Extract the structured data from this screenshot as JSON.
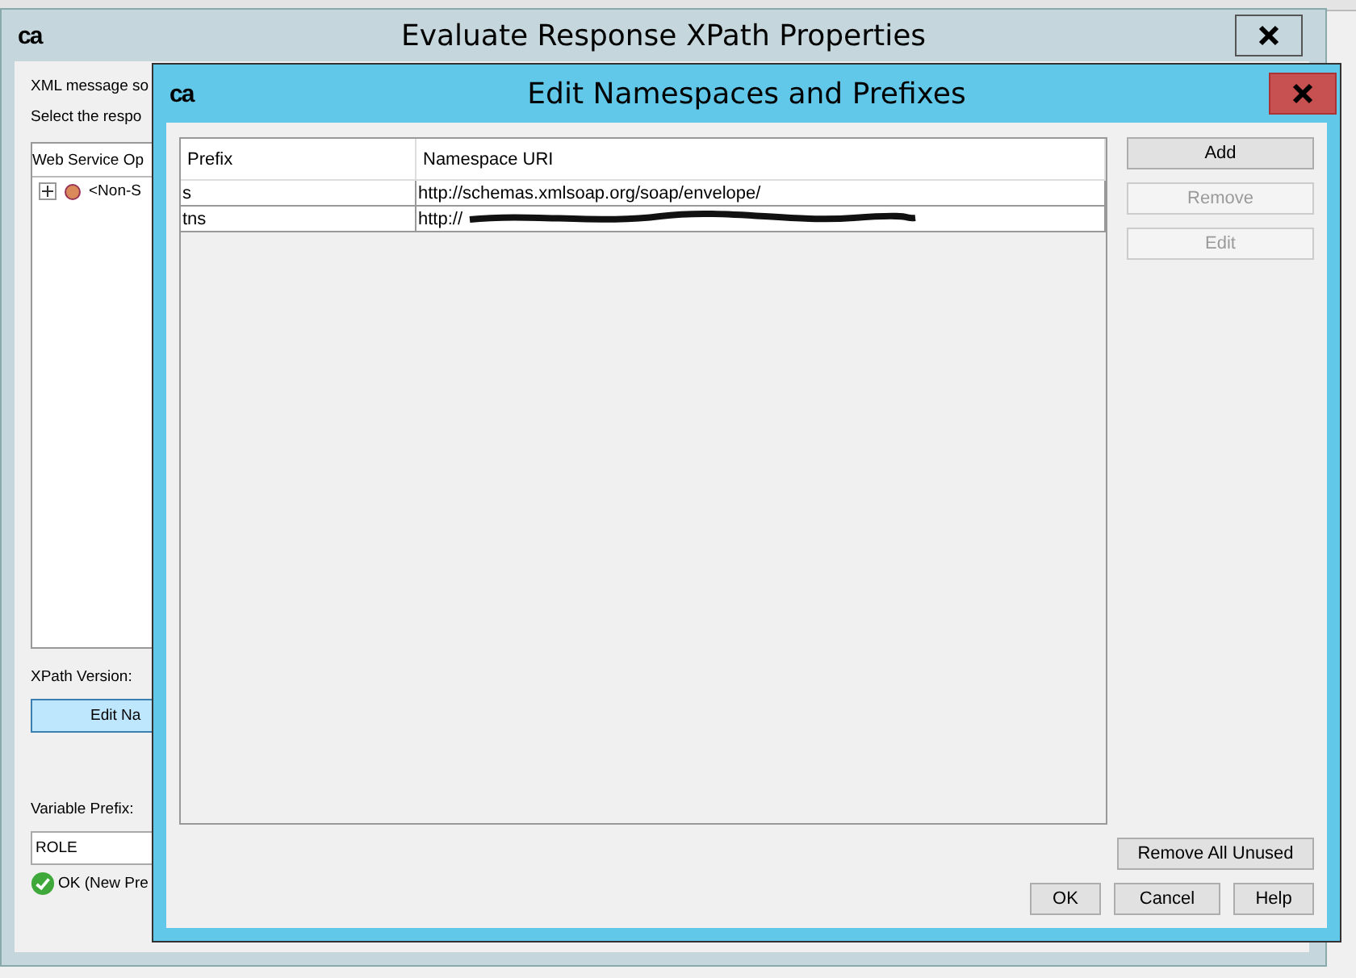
{
  "outer_window": {
    "logo": "ca",
    "title": "Evaluate Response XPath Properties",
    "texts": [
      "XML message so",
      "Select the respo"
    ],
    "tree_title": "Web Service Op",
    "tree_item": "<Non-S",
    "xpath_version_label": "XPath Version:",
    "edit_button": "Edit Na",
    "variable_prefix_label": "Variable Prefix:",
    "variable_prefix_value": "ROLE",
    "status": "OK (New Pre"
  },
  "dialog": {
    "logo": "ca",
    "title": "Edit Namespaces and Prefixes",
    "table": {
      "columns": [
        "Prefix",
        "Namespace URI"
      ],
      "rows": [
        {
          "prefix": "s",
          "uri": "http://schemas.xmlsoap.org/soap/envelope/",
          "redacted": false
        },
        {
          "prefix": "tns",
          "uri": "http://",
          "redacted": true
        }
      ]
    },
    "side_buttons": [
      {
        "label": "Add",
        "disabled": false
      },
      {
        "label": "Remove",
        "disabled": true
      },
      {
        "label": "Edit",
        "disabled": true
      }
    ],
    "remove_unused": "Remove All Unused",
    "buttons": [
      "OK",
      "Cancel",
      "Help"
    ]
  }
}
